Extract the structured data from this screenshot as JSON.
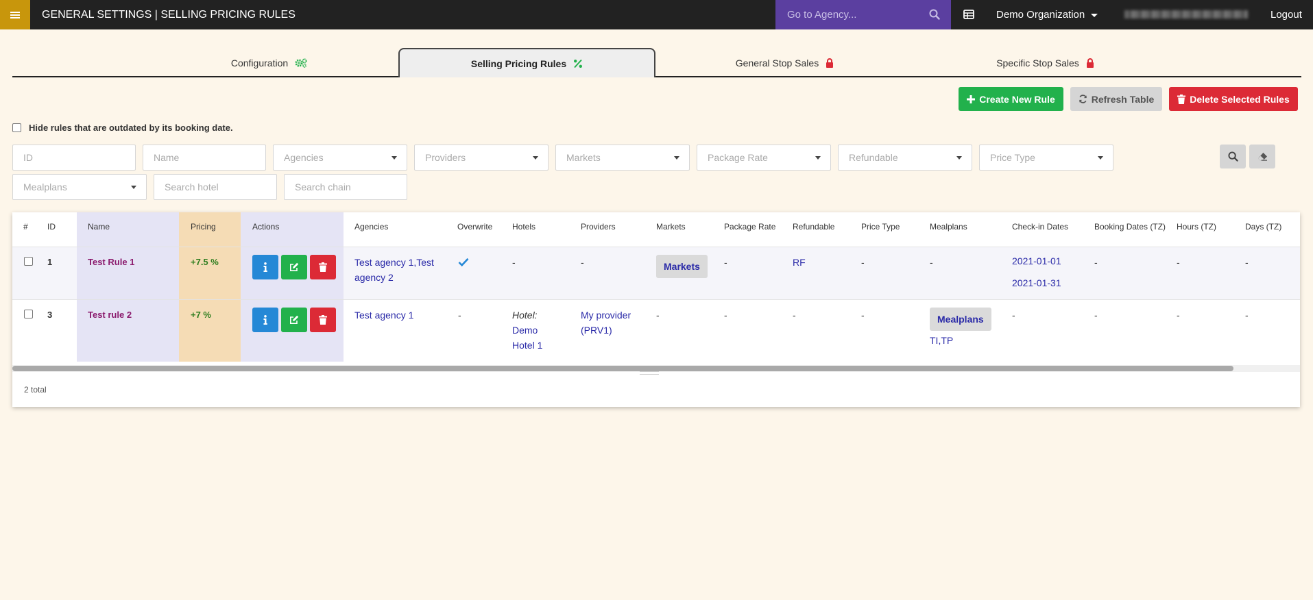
{
  "header": {
    "title": "GENERAL SETTINGS | SELLING PRICING RULES",
    "agency_search_placeholder": "Go to Agency...",
    "organization": "Demo Organization",
    "logout_label": "Logout",
    "accent_color": "#c8960c",
    "search_bg": "#5b3fa0"
  },
  "tabs": [
    {
      "label": "Configuration",
      "icon": "gears-icon"
    },
    {
      "label": "Selling Pricing Rules",
      "icon": "percent-icon",
      "active": true
    },
    {
      "label": "General Stop Sales",
      "icon": "lock-icon"
    },
    {
      "label": "Specific Stop Sales",
      "icon": "lock-icon"
    }
  ],
  "toolbar": {
    "create_label": "Create New Rule",
    "refresh_label": "Refresh Table",
    "delete_label": "Delete Selected Rules"
  },
  "hide_outdated_label": "Hide rules that are outdated by its booking date.",
  "filters": {
    "id": "ID",
    "name": "Name",
    "agencies": "Agencies",
    "providers": "Providers",
    "markets": "Markets",
    "package_rate": "Package Rate",
    "refundable": "Refundable",
    "price_type": "Price Type",
    "mealplans": "Mealplans",
    "search_hotel": "Search hotel",
    "search_chain": "Search chain"
  },
  "table": {
    "headers": [
      "#",
      "ID",
      "Name",
      "Pricing",
      "Actions",
      "Agencies",
      "Overwrite",
      "Hotels",
      "Providers",
      "Markets",
      "Package Rate",
      "Refundable",
      "Price Type",
      "Mealplans",
      "Check-in Dates",
      "Booking Dates (TZ)",
      "Hours (TZ)",
      "Days (TZ)"
    ],
    "rows": [
      {
        "id": "1",
        "name": "Test Rule 1",
        "pricing": "+7.5 %",
        "agencies_line1": "Test agency 1,Test",
        "agencies_line2": "agency 2",
        "overwrite": true,
        "hotels": "-",
        "providers": "-",
        "markets_badge": "Markets",
        "package_rate": "-",
        "refundable": "RF",
        "price_type": "-",
        "mealplans": "-",
        "checkin_from": "2021-01-01",
        "checkin_to": "2021-01-31",
        "booking_dates": "-",
        "hours": "-",
        "days": "-"
      },
      {
        "id": "3",
        "name": "Test rule 2",
        "pricing": "+7 %",
        "agencies": "Test agency 1",
        "overwrite": "-",
        "hotel_prefix": "Hotel:",
        "hotel_line1": "Demo",
        "hotel_line2": "Hotel 1",
        "provider_line1": "My provider",
        "provider_line2": "(PRV1)",
        "markets": "-",
        "package_rate": "-",
        "refundable": "-",
        "price_type": "-",
        "mealplans_badge": "Mealplans",
        "mealplans_text": "TI,TP",
        "checkin": "-",
        "booking_dates": "-",
        "hours": "-",
        "days": "-"
      }
    ],
    "total": "2 total"
  }
}
